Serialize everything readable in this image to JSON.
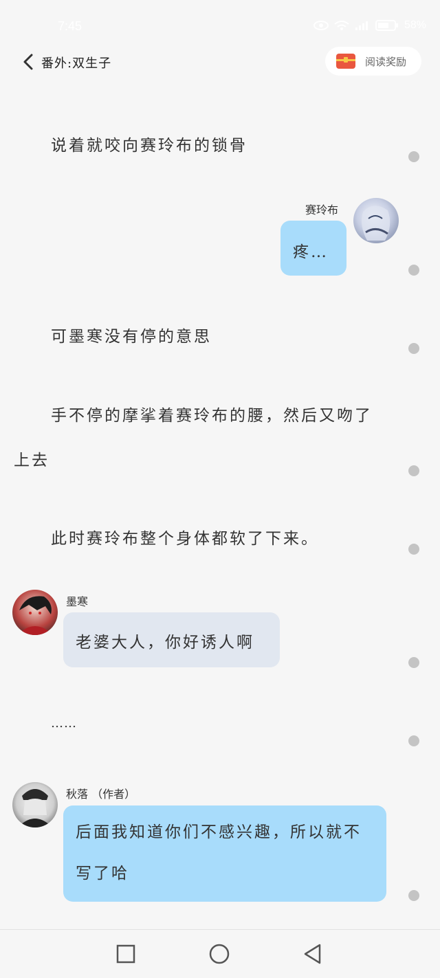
{
  "status_bar": {
    "time": "7:45",
    "battery": "58%"
  },
  "header": {
    "title": "番外:双生子",
    "reward_label": "阅读奖励"
  },
  "narration": [
    "说着就咬向赛玲布的锁骨",
    "可墨寒没有停的意思",
    "手不停的摩挲着赛玲布的腰，然后又吻了",
    "上去",
    "此时赛玲布整个身体都软了下来。",
    "……"
  ],
  "messages": [
    {
      "name": "赛玲布",
      "text": "疼…"
    },
    {
      "name": "墨寒",
      "text": "老婆大人，你好诱人啊"
    },
    {
      "name": "秋落 （作者）",
      "line1": "后面我知道你们不感兴趣，所以就不",
      "line2": "写了哈"
    }
  ],
  "colors": {
    "blue_bubble": "#a8dcfb",
    "gray_bubble": "#e1e7f0",
    "background": "#f6f6f6"
  }
}
